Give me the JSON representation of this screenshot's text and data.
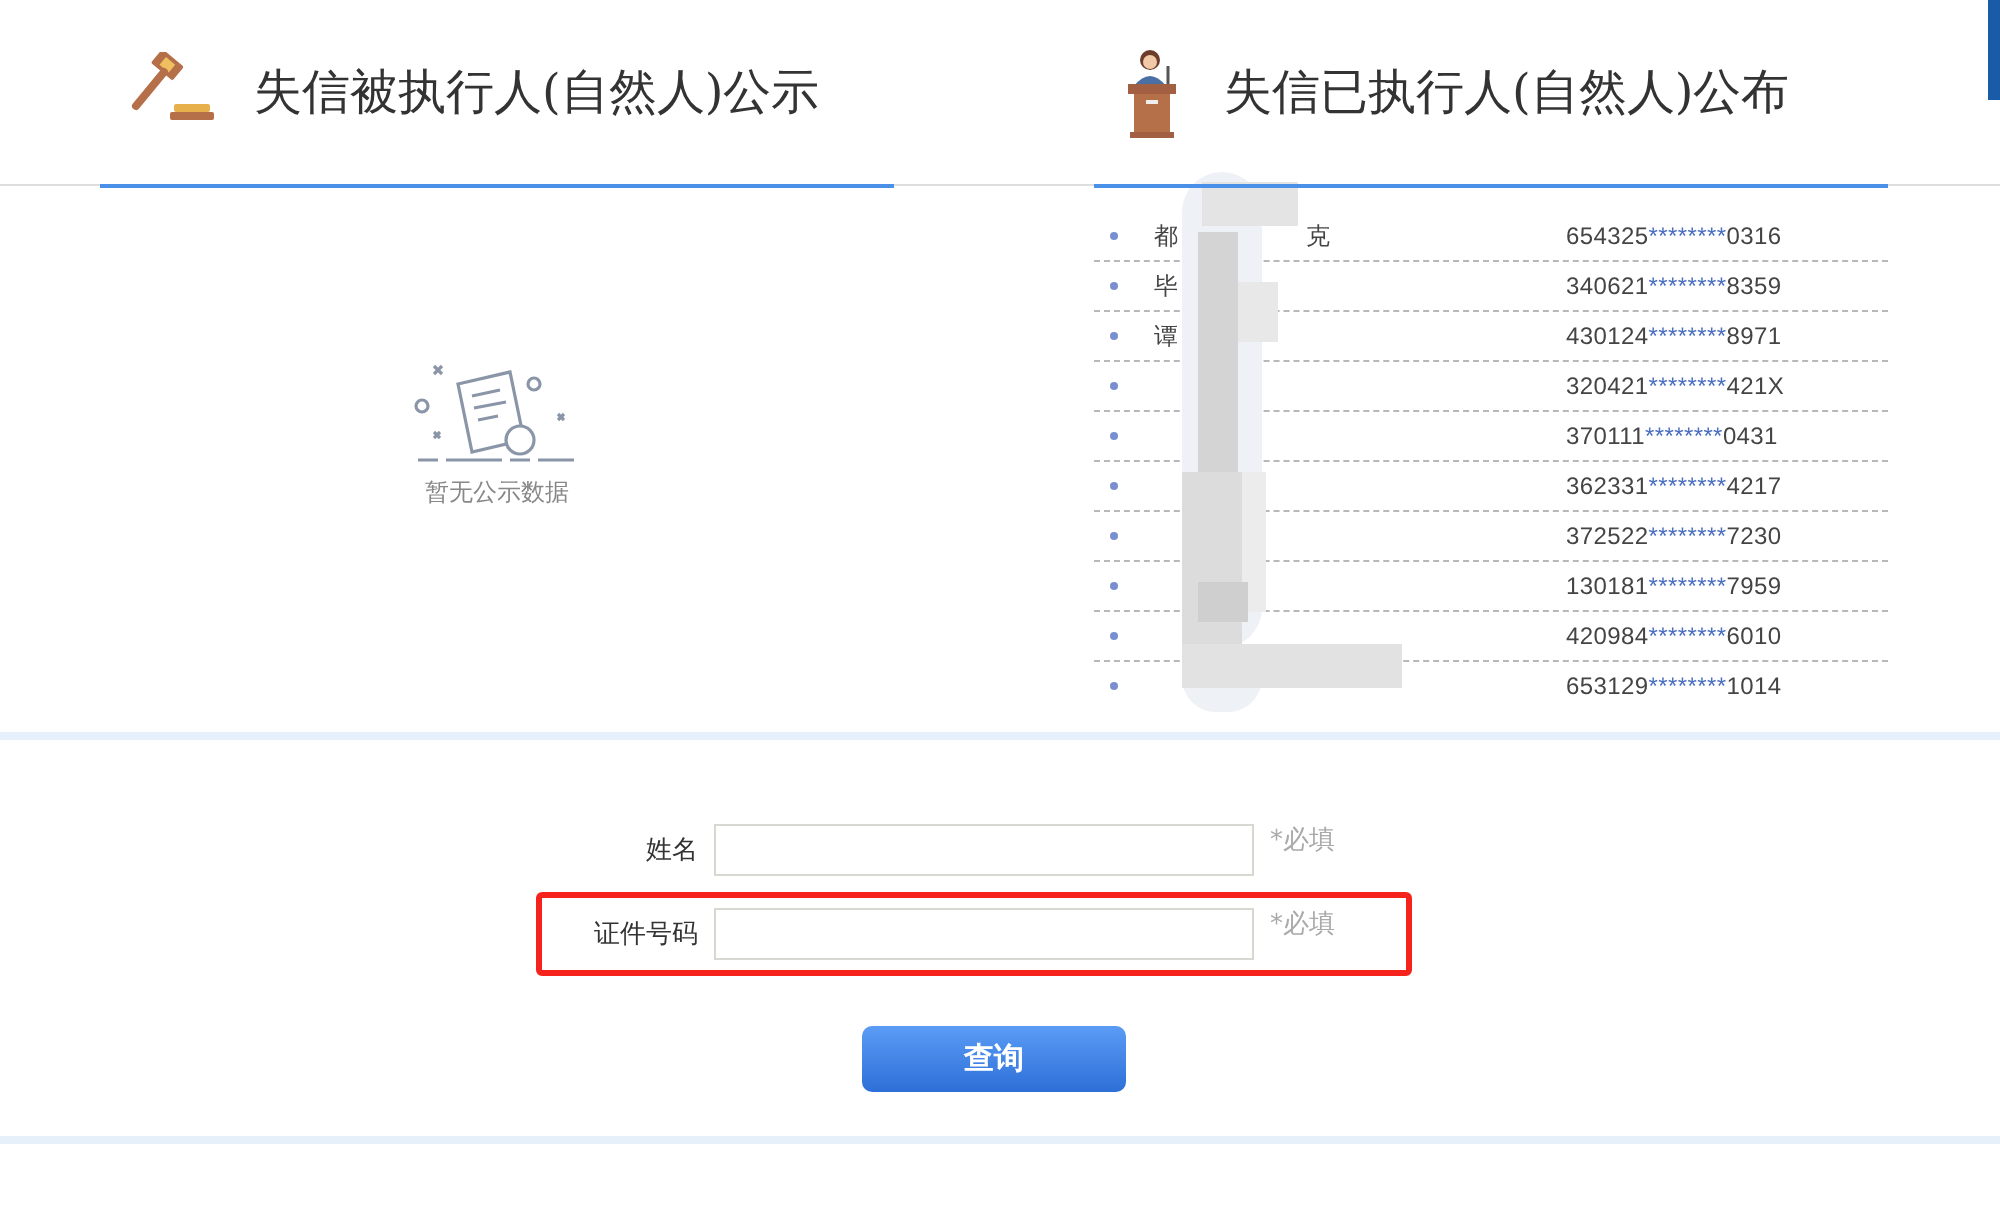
{
  "panels": [
    {
      "title": "失信被执行人(自然人)公示",
      "selected": true
    },
    {
      "title": "失信已执行人(自然人)公布",
      "selected": true
    }
  ],
  "empty_state": {
    "text": "暂无公示数据"
  },
  "list": [
    {
      "name": "都",
      "name_tail": "克",
      "id_head": "654325",
      "id_mask": "********",
      "id_tail": "0316"
    },
    {
      "name": "毕",
      "id_head": "340621",
      "id_mask": "********",
      "id_tail": "8359"
    },
    {
      "name": "谭",
      "id_head": "430124",
      "id_mask": "********",
      "id_tail": "8971"
    },
    {
      "id_head": "320421",
      "id_mask": "********",
      "id_tail": "421X"
    },
    {
      "id_head": "370111",
      "id_mask": "********",
      "id_tail": "0431"
    },
    {
      "id_head": "362331",
      "id_mask": "********",
      "id_tail": "4217"
    },
    {
      "id_head": "372522",
      "id_mask": "********",
      "id_tail": "7230"
    },
    {
      "id_head": "130181",
      "id_mask": "********",
      "id_tail": "7959"
    },
    {
      "id_head": "420984",
      "id_mask": "********",
      "id_tail": "6010"
    },
    {
      "id_head": "653129",
      "id_mask": "********",
      "id_tail": "1014"
    }
  ],
  "form": {
    "fields": [
      {
        "label": "姓名",
        "required_note": "*必填",
        "highlighted": false
      },
      {
        "label": "证件号码",
        "required_note": "*必填",
        "highlighted": true
      }
    ],
    "submit": "查询"
  }
}
